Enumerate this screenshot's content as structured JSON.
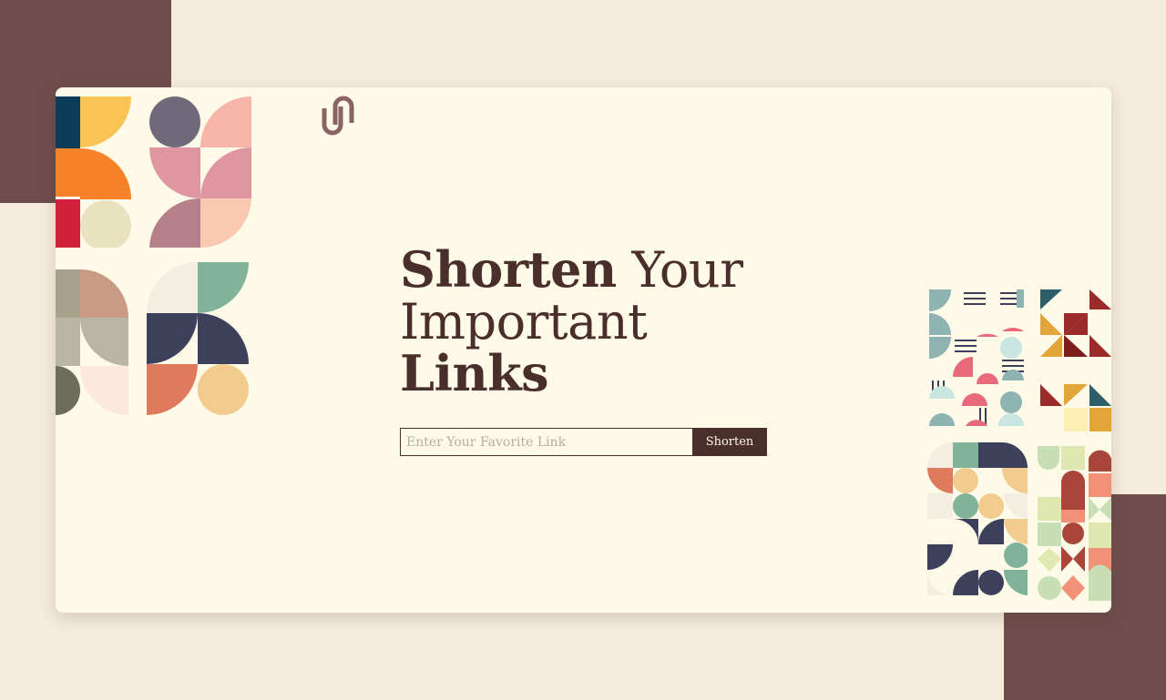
{
  "colors": {
    "brown": "#4a2e2b",
    "muted_brown": "#6e4e4d",
    "cream": "#fefae8",
    "page_bg": "#f5ecdc"
  },
  "logo": {
    "icon": "link-logo-icon"
  },
  "hero": {
    "title_line1_bold": "Shorten",
    "title_line1_rest": " Your",
    "title_line2": "Important",
    "title_line3": "Links"
  },
  "form": {
    "input_value": "",
    "input_placeholder": "Enter Your Favorite Link",
    "button_label": "Shorten"
  }
}
